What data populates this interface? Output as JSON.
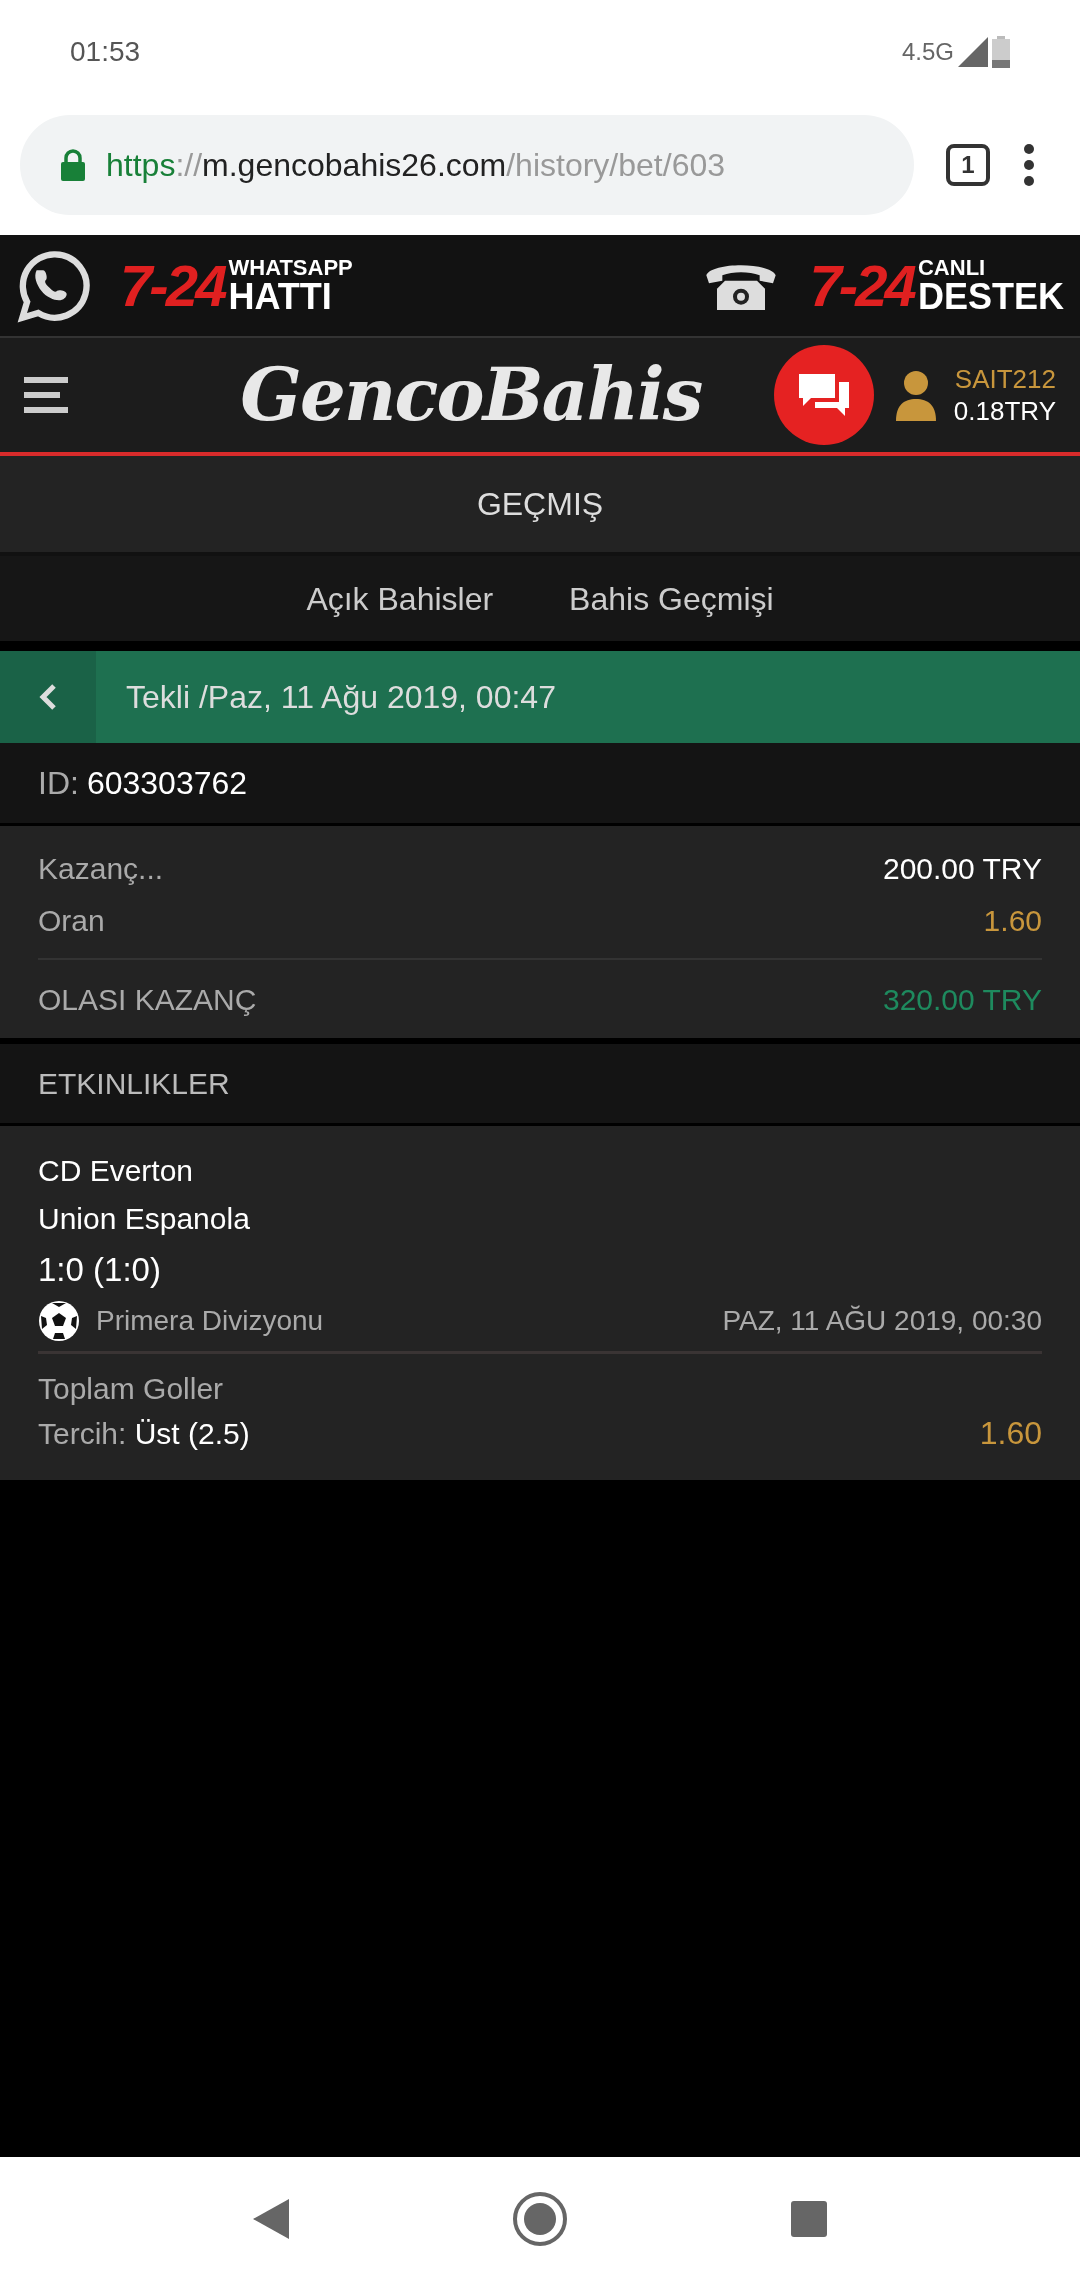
{
  "status_bar": {
    "time": "01:53",
    "network": "4.5G"
  },
  "browser": {
    "url_scheme": "https",
    "url_sep": "://",
    "url_host": "m.gencobahis26.com",
    "url_path": "/history/bet/603",
    "tab_count": "1"
  },
  "banner": {
    "left": {
      "number": "7-24",
      "line1": "WHATSAPP",
      "line2": "HATTI"
    },
    "right": {
      "number": "7-24",
      "line1": "CANLI",
      "line2": "DESTEK"
    }
  },
  "header": {
    "logo": "GencoBahis",
    "username": "SAIT212",
    "balance": "0.18TRY"
  },
  "page_title": "GEÇMIŞ",
  "tabs": [
    {
      "label": "Açık Bahisler"
    },
    {
      "label": "Bahis Geçmişi"
    }
  ],
  "bet_header": {
    "title": "Tekli /Paz, 11 Ağu 2019, 00:47"
  },
  "bet_id": {
    "label": "ID:",
    "value": "603303762"
  },
  "summary": {
    "stake_label": "Kazanç...",
    "stake": "200.00 TRY",
    "odds_label": "Oran",
    "odds": "1.60",
    "potential_label": "OLASI KAZANÇ",
    "potential": "320.00 TRY"
  },
  "events_title": "ETKINLIKLER",
  "events": [
    {
      "home": "CD Everton",
      "away": "Union Espanola",
      "score": "1:0 (1:0)",
      "league": "Primera Divizyonu",
      "date": "PAZ, 11 AĞU 2019, 00:30",
      "market": "Toplam Goller",
      "choice_label": "Tercih:",
      "choice": "Üst (2.5)",
      "odds": "1.60"
    }
  ]
}
